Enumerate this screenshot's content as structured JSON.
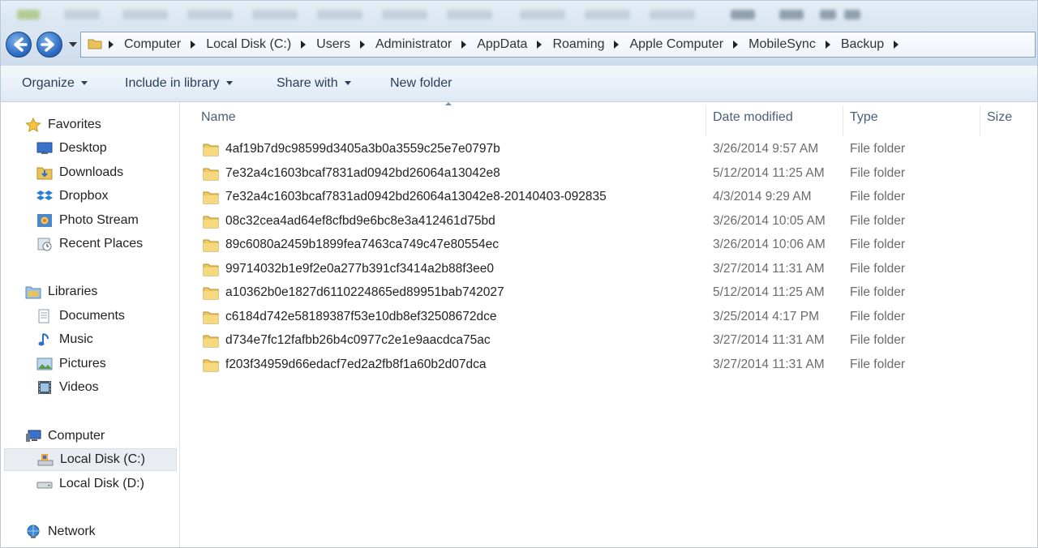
{
  "address": {
    "crumbs": [
      "Computer",
      "Local Disk (C:)",
      "Users",
      "Administrator",
      "AppData",
      "Roaming",
      "Apple Computer",
      "MobileSync",
      "Backup"
    ]
  },
  "toolbar": {
    "organize": "Organize",
    "include_in_library": "Include in library",
    "share_with": "Share with",
    "new_folder": "New folder"
  },
  "nav": {
    "favorites": "Favorites",
    "desktop": "Desktop",
    "downloads": "Downloads",
    "dropbox": "Dropbox",
    "photo_stream": "Photo Stream",
    "recent_places": "Recent Places",
    "libraries": "Libraries",
    "documents": "Documents",
    "music": "Music",
    "pictures": "Pictures",
    "videos": "Videos",
    "computer": "Computer",
    "local_disk_c": "Local Disk (C:)",
    "local_disk_d": "Local Disk (D:)",
    "network": "Network"
  },
  "columns": {
    "name": "Name",
    "date_modified": "Date modified",
    "type": "Type",
    "size": "Size"
  },
  "files": [
    {
      "name": "4af19b7d9c98599d3405a3b0a3559c25e7e0797b",
      "date": "3/26/2014 9:57 AM",
      "type": "File folder"
    },
    {
      "name": "7e32a4c1603bcaf7831ad0942bd26064a13042e8",
      "date": "5/12/2014 11:25 AM",
      "type": "File folder"
    },
    {
      "name": "7e32a4c1603bcaf7831ad0942bd26064a13042e8-20140403-092835",
      "date": "4/3/2014 9:29 AM",
      "type": "File folder"
    },
    {
      "name": "08c32cea4ad64ef8cfbd9e6bc8e3a412461d75bd",
      "date": "3/26/2014 10:05 AM",
      "type": "File folder"
    },
    {
      "name": "89c6080a2459b1899fea7463ca749c47e80554ec",
      "date": "3/26/2014 10:06 AM",
      "type": "File folder"
    },
    {
      "name": "99714032b1e9f2e0a277b391cf3414a2b88f3ee0",
      "date": "3/27/2014 11:31 AM",
      "type": "File folder"
    },
    {
      "name": "a10362b0e1827d6110224865ed89951bab742027",
      "date": "5/12/2014 11:25 AM",
      "type": "File folder"
    },
    {
      "name": "c6184d742e58189387f53e10db8ef32508672dce",
      "date": "3/25/2014 4:17 PM",
      "type": "File folder"
    },
    {
      "name": "d734e7fc12fafbb26b4c0977c2e1e9aacdca75ac",
      "date": "3/27/2014 11:31 AM",
      "type": "File folder"
    },
    {
      "name": "f203f34959d66edacf7ed2a2fb8f1a60b2d07dca",
      "date": "3/27/2014 11:31 AM",
      "type": "File folder"
    }
  ]
}
